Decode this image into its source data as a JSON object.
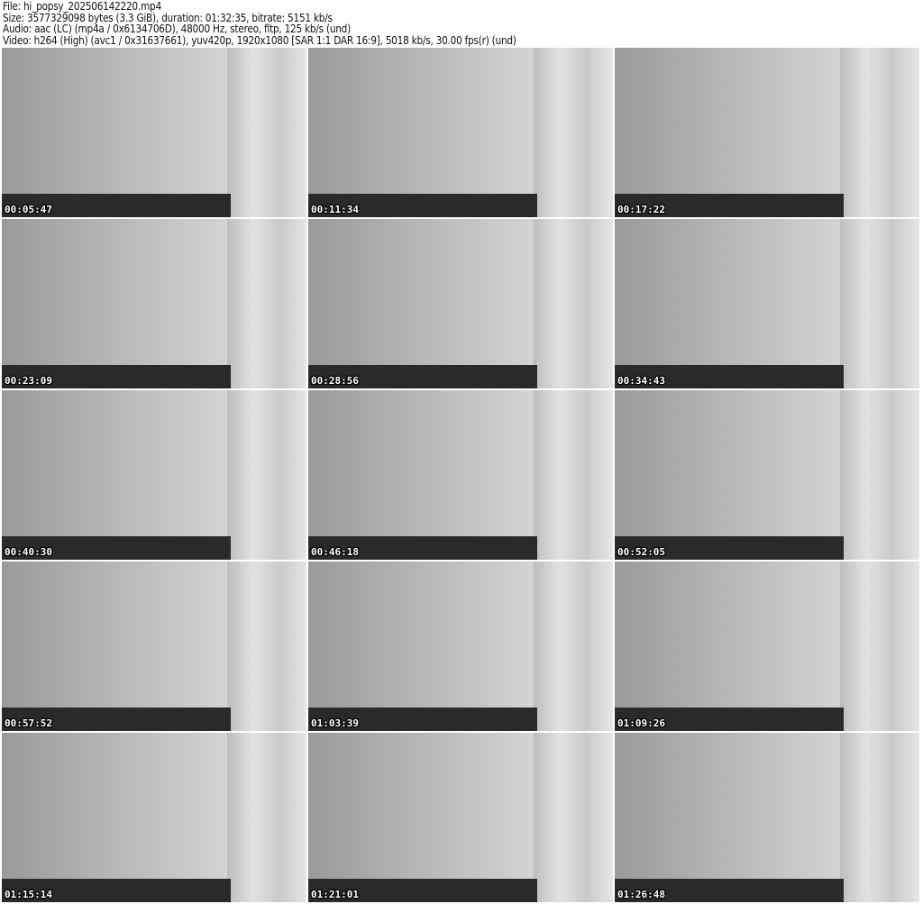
{
  "header": {
    "file": "File: hi_popsy_202506142220.mp4",
    "size": "Size: 3577329098 bytes (3.3 GiB), duration: 01:32:35, bitrate: 5151 kb/s",
    "audio": "Audio: aac (LC) (mp4a / 0x6134706D), 48000 Hz, stereo, fltp, 125 kb/s (und)",
    "video": "Video: h264 (High) (avc1 / 0x31637661), yuv420p, 1920x1080 [SAR 1:1 DAR 16:9], 5018 kb/s, 30.00 fps(r) (und)"
  },
  "thumbnails": [
    {
      "timestamp": "00:05:47"
    },
    {
      "timestamp": "00:11:34"
    },
    {
      "timestamp": "00:17:22"
    },
    {
      "timestamp": "00:23:09"
    },
    {
      "timestamp": "00:28:56"
    },
    {
      "timestamp": "00:34:43"
    },
    {
      "timestamp": "00:40:30"
    },
    {
      "timestamp": "00:46:18"
    },
    {
      "timestamp": "00:52:05"
    },
    {
      "timestamp": "00:57:52"
    },
    {
      "timestamp": "01:03:39"
    },
    {
      "timestamp": "01:09:26"
    },
    {
      "timestamp": "01:15:14"
    },
    {
      "timestamp": "01:21:01"
    },
    {
      "timestamp": "01:26:48"
    }
  ]
}
